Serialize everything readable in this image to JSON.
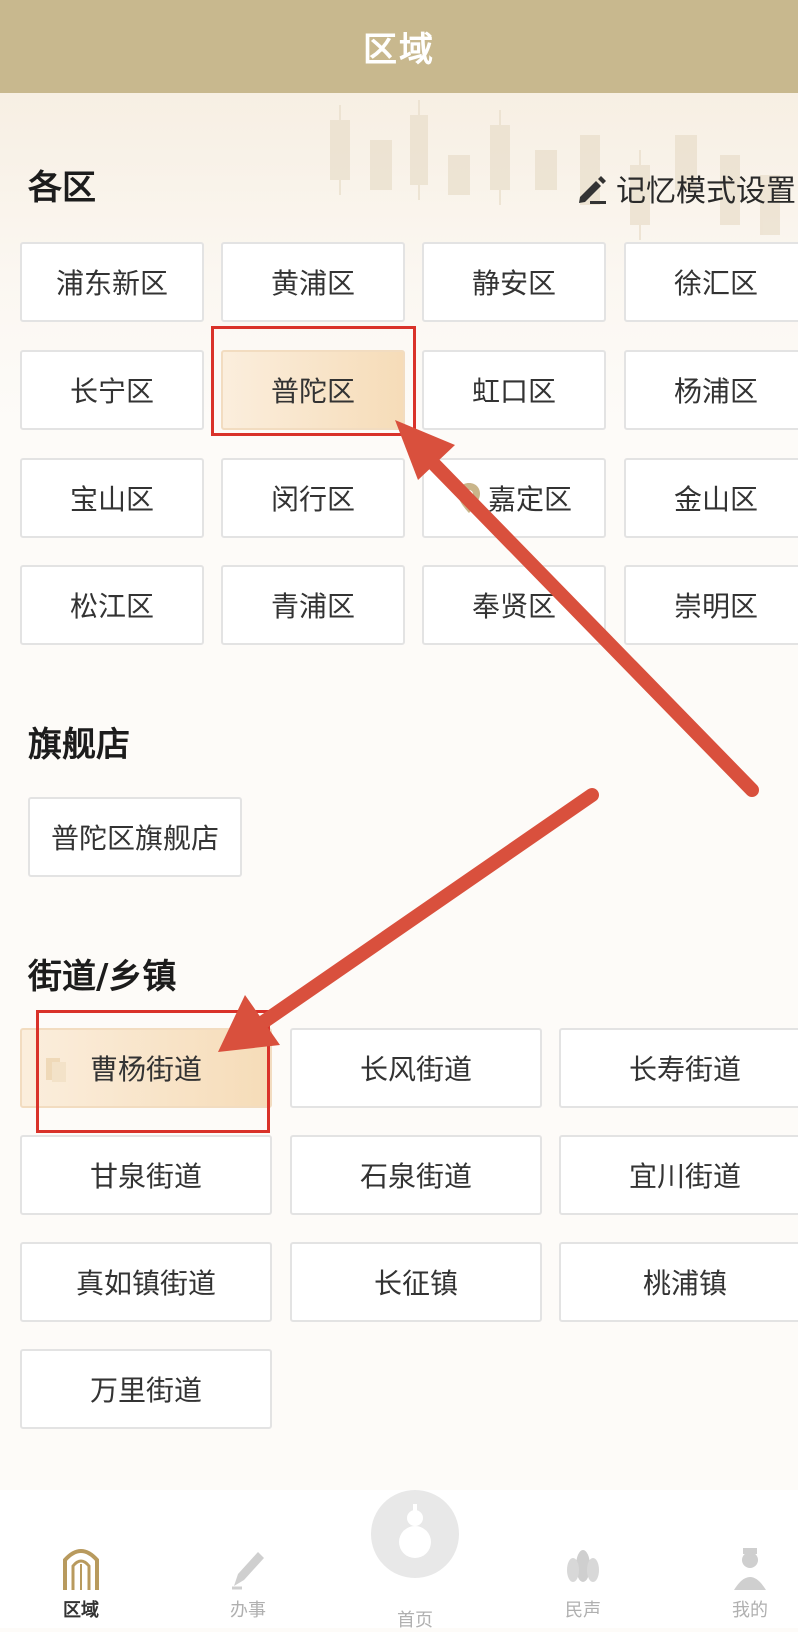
{
  "header": {
    "title": "区域"
  },
  "districts": {
    "title": "各区",
    "memory_label": "记忆模式设置",
    "items": [
      "浦东新区",
      "黄浦区",
      "静安区",
      "徐汇区",
      "长宁区",
      "普陀区",
      "虹口区",
      "杨浦区",
      "宝山区",
      "闵行区",
      "嘉定区",
      "金山区",
      "松江区",
      "青浦区",
      "奉贤区",
      "崇明区"
    ],
    "selected": "普陀区"
  },
  "flagship": {
    "title": "旗舰店",
    "items": [
      "普陀区旗舰店"
    ]
  },
  "streets": {
    "title": "街道/乡镇",
    "items": [
      "曹杨街道",
      "长风街道",
      "长寿街道",
      "甘泉街道",
      "石泉街道",
      "宜川街道",
      "真如镇街道",
      "长征镇",
      "桃浦镇",
      "万里街道"
    ],
    "selected": "曹杨街道"
  },
  "bottom_nav": {
    "items": [
      {
        "label": "区域",
        "icon": "gate-icon",
        "active": true
      },
      {
        "label": "办事",
        "icon": "pen-icon",
        "active": false
      },
      {
        "label": "首页",
        "icon": "gourd-icon",
        "active": false
      },
      {
        "label": "民声",
        "icon": "flower-icon",
        "active": false
      },
      {
        "label": "我的",
        "icon": "person-icon",
        "active": false
      }
    ]
  },
  "colors": {
    "header": "#c8b88e",
    "highlight": "#d9322a",
    "selected_bg": "#f6dcb8"
  }
}
